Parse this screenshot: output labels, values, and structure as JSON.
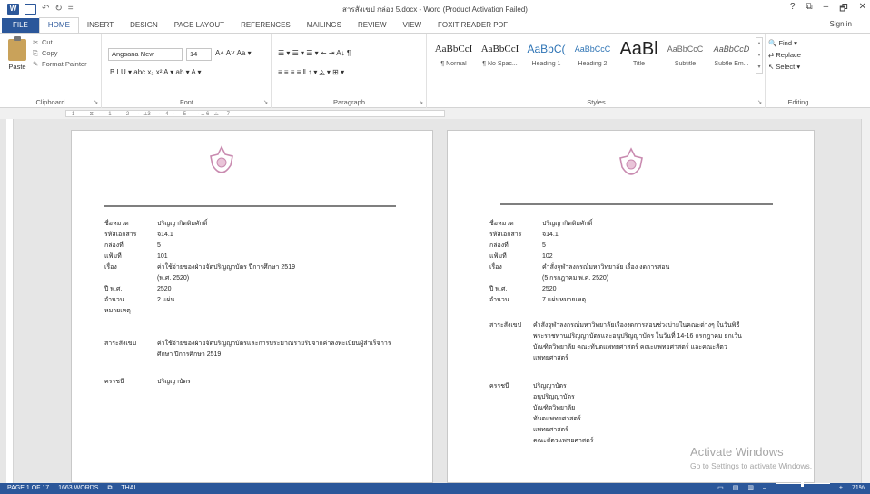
{
  "titlebar": {
    "title": "สารสังเขป กล่อง 5.docx - Word (Product Activation Failed)",
    "help": "?",
    "ribbon_opts": "⧉",
    "minimize": "–",
    "restore": "🗗",
    "close": "✕",
    "undo": "↶",
    "redo": "↻",
    "customize": "="
  },
  "tabs": [
    "FILE",
    "HOME",
    "INSERT",
    "DESIGN",
    "PAGE LAYOUT",
    "REFERENCES",
    "MAILINGS",
    "REVIEW",
    "VIEW",
    "FOXIT READER PDF"
  ],
  "active_tab": "HOME",
  "signin": "Sign in",
  "clipboard": {
    "paste": "Paste",
    "cut": "Cut",
    "copy": "Copy",
    "format_painter": "Format Painter",
    "label": "Clipboard"
  },
  "font": {
    "name": "Angsana New",
    "size": "14",
    "label": "Font",
    "row1_extra": "A˄  A˅   Aa ▾",
    "row2": "B  I  U ▾  abc  x₂  x²   A ▾  ab ▾  A ▾"
  },
  "paragraph": {
    "label": "Paragraph",
    "row1": "☰ ▾  ☰ ▾  ☰ ▾   ⇤  ⇥   A↓  ¶",
    "row2": "≡  ≡  ≡  ≡  ‖   ↕ ▾   ◬ ▾  ⊞ ▾"
  },
  "styles": {
    "label": "Styles",
    "items": [
      {
        "sample": "AaBbCcI",
        "name": "¶ Normal"
      },
      {
        "sample": "AaBbCcI",
        "name": "¶ No Spac..."
      },
      {
        "sample": "AaBbC(",
        "name": "Heading 1"
      },
      {
        "sample": "AaBbCcC",
        "name": "Heading 2"
      },
      {
        "sample": "AaBl",
        "name": "Title"
      },
      {
        "sample": "AaBbCcC",
        "name": "Subtitle"
      },
      {
        "sample": "AaBbCcD",
        "name": "Subtle Em..."
      }
    ]
  },
  "editing": {
    "label": "Editing",
    "find": "Find ▾",
    "replace": "Replace",
    "select": "Select ▾"
  },
  "ruler": {
    "marks": "1 · · · · ⧖ · · · · 1 · · · · 2 · · · · ⊥3 · · · · 4 · · · · 5 · · · · ⊥ 6 · △ · · 7 · ·"
  },
  "page1": {
    "fields": [
      {
        "k": "ชื่อหมวด",
        "v": "ปริญญากิตติมศักดิ์"
      },
      {
        "k": "รหัสเอกสาร",
        "v": "จ14.1"
      },
      {
        "k": "กล่องที่",
        "v": "5"
      },
      {
        "k": "แฟ้มที่",
        "v": "101"
      },
      {
        "k": "เรื่อง",
        "v": "ค่าใช้จ่ายของฝ่ายจัดปริญญาบัตร ปีการศึกษา 2519"
      },
      {
        "k": "",
        "v": "(พ.ศ. 2520)"
      },
      {
        "k": "ปี พ.ศ.",
        "v": "2520"
      },
      {
        "k": "จำนวน",
        "v": "2 แผ่น"
      },
      {
        "k": "หมายเหตุ",
        "v": ""
      }
    ],
    "summary_k": "สาระสังเขป",
    "summary_v": "ค่าใช้จ่ายของฝ่ายจัดปริญญาบัตรและการประมาณรายรับจากค่าลงทะเบียนผู้สำเร็จการศึกษา ปีการศึกษา 2519",
    "keywords_k": "ครรชนี",
    "keywords_v": "ปริญญาบัตร"
  },
  "page2": {
    "fields": [
      {
        "k": "ชื่อหมวด",
        "v": "ปริญญากิตติมศักดิ์"
      },
      {
        "k": "รหัสเอกสาร",
        "v": "จ14.1"
      },
      {
        "k": "กล่องที่",
        "v": "5"
      },
      {
        "k": "แฟ้มที่",
        "v": "102"
      },
      {
        "k": "เรื่อง",
        "v": "คำสั่งจุฬาลงกรณ์มหาวิทยาลัย เรื่อง งดการสอน"
      },
      {
        "k": "",
        "v": "(5 กรกฎาคม พ.ศ. 2520)"
      },
      {
        "k": "ปี พ.ศ.",
        "v": "2520"
      },
      {
        "k": "จำนวน",
        "v": "7 แผ่นหมายเหตุ"
      }
    ],
    "summary_k": "สาระสังเขป",
    "summary_lines": [
      "คำสั่งจุฬาลงกรณ์มหาวิทยาลัยเรื่องงดการสอนช่วงบ่ายในคณะต่างๆ ในวันพิธี",
      "พระราชทานปริญญาบัตรและอนุปริญญาบัตร ในวันที่ 14-16 กรกฎาคม ยกเว้น",
      "บัณฑิตวิทยาลัย คณะทันตแพทยศาสตร์ คณะแพทยศาสตร์ และคณะสัตว",
      "แพทยศาสตร์"
    ],
    "keywords_k": "ครรชนี",
    "keywords_lines": [
      "ปริญญาบัตร",
      "อนุปริญญาบัตร",
      "บัณฑิตวิทยาลัย",
      "ทันตแพทยศาสตร์",
      "แพทยศาสตร์",
      "คณะสัตวแพทยศาสตร์"
    ]
  },
  "watermark": {
    "line1": "Activate Windows",
    "line2": "Go to Settings to activate Windows."
  },
  "statusbar": {
    "page": "PAGE 1 OF 17",
    "words": "1663 WORDS",
    "lang": "THAI",
    "zoom": "71%"
  },
  "colors": {
    "accent": "#2b579a",
    "seal": "#c98bb0"
  }
}
